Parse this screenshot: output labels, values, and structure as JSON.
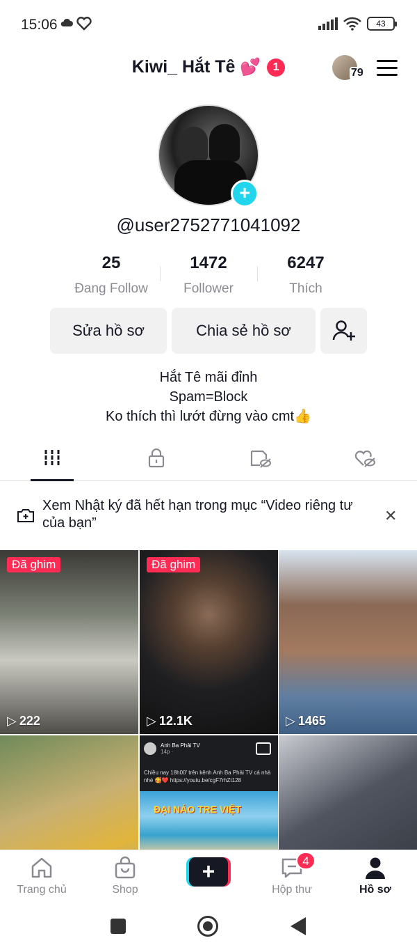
{
  "status_bar": {
    "time": "15:06",
    "battery": "43"
  },
  "header": {
    "title": "Kiwi_ Hắt Tê",
    "title_emoji": "💕",
    "notification_count": "1",
    "friends_count": "79"
  },
  "profile": {
    "username": "@user2752771041092",
    "stats": [
      {
        "value": "25",
        "label": "Đang Follow"
      },
      {
        "value": "1472",
        "label": "Follower"
      },
      {
        "value": "6247",
        "label": "Thích"
      }
    ],
    "buttons": {
      "edit": "Sửa hồ sơ",
      "share": "Chia sẻ hồ sơ"
    },
    "bio": [
      "Hắt Tê mãi đỉnh",
      "Spam=Block",
      "Ko thích thì lướt đừng vào cmt👍"
    ]
  },
  "notice": {
    "text": "Xem Nhật ký đã hết hạn trong mục “Video riêng tư của bạn”"
  },
  "videos": [
    {
      "pinned_label": "Đã ghim",
      "views": "222"
    },
    {
      "pinned_label": "Đã ghim",
      "views": "12.1K"
    },
    {
      "views": "1465"
    },
    {},
    {
      "fb_name": "Anh Ba Phải TV",
      "fb_time": "14p · ",
      "fb_text": "Chiều nay 18h00' trên kênh Anh Ba Phải TV cả nhà nhé 🥰❤️ https://youtu.be/cgF7rhZt128",
      "fb_banner": "ĐẠI NÁO TRE VIỆT"
    },
    {}
  ],
  "bottom_nav": {
    "home": "Trang chủ",
    "shop": "Shop",
    "inbox": "Hộp thư",
    "inbox_badge": "4",
    "profile": "Hồ sơ"
  },
  "colors": {
    "accent_red": "#fe2c55",
    "accent_cyan": "#20d5ec",
    "text": "#161823",
    "muted": "#8a8b91"
  }
}
